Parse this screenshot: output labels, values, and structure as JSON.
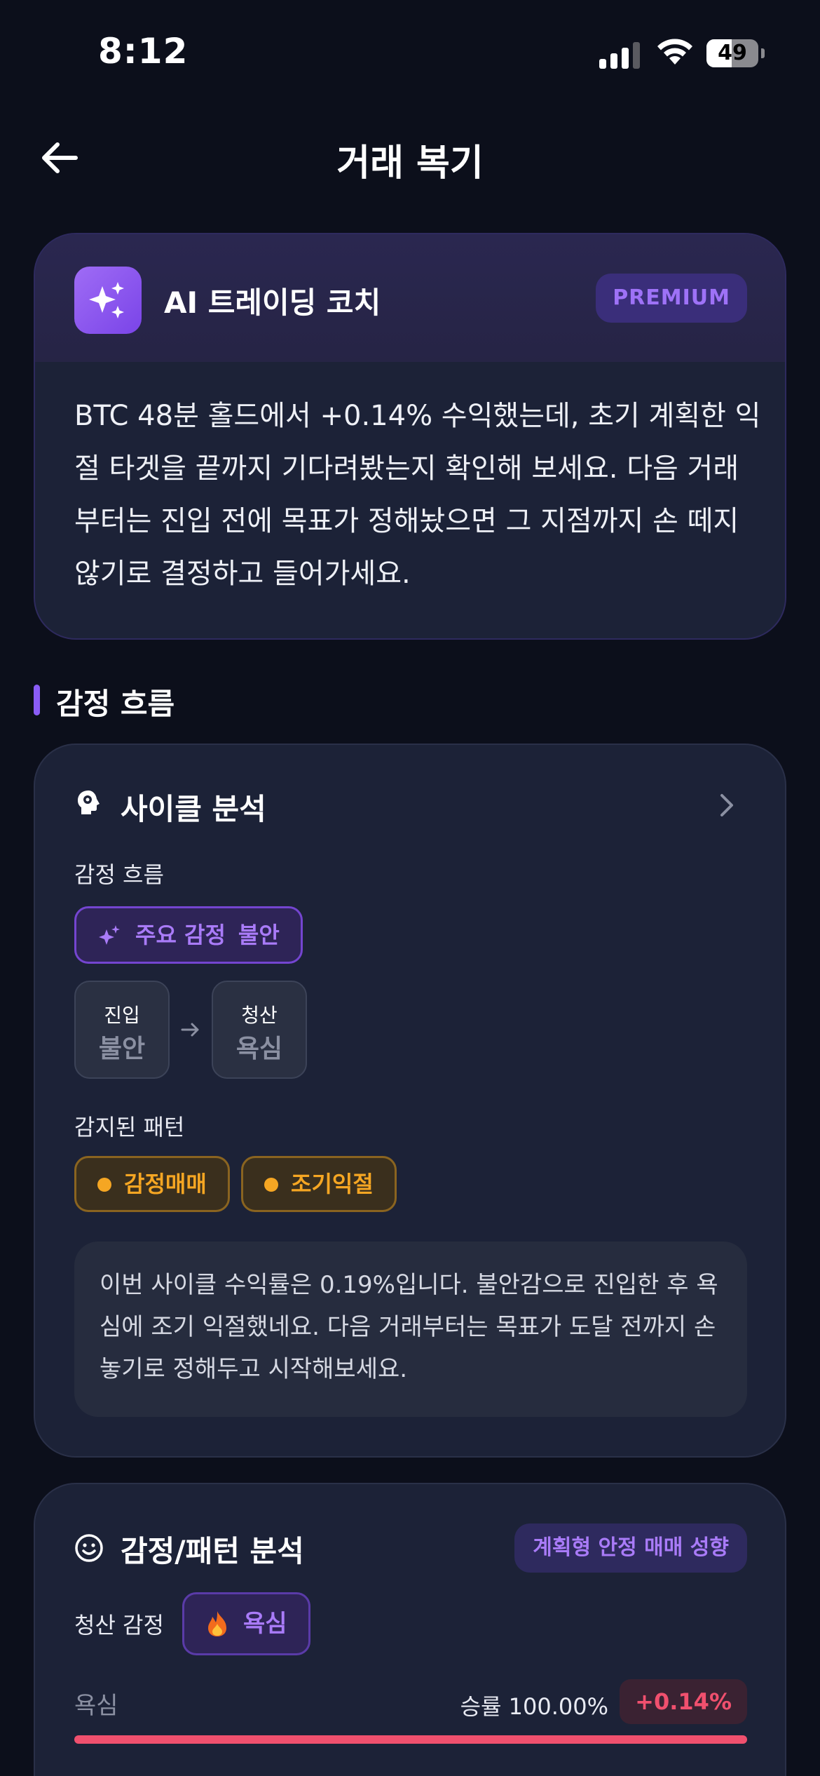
{
  "status_bar": {
    "time": "8:12",
    "battery": "49",
    "battery_level": 0.49
  },
  "header": {
    "title": "거래 복기"
  },
  "coach": {
    "title": "AI 트레이딩 코치",
    "badge": "PREMIUM",
    "message": "BTC 48분 홀드에서 +0.14% 수익했는데, 초기 계획한 익절 타겟을 끝까지 기다려봤는지 확인해 보세요. 다음 거래부터는 진입 전에 목표가 정해놨으면 그 지점까지 손 떼지 않기로 결정하고 들어가세요."
  },
  "section": {
    "title": "감정 흐름"
  },
  "cycle": {
    "title": "사이클 분석",
    "flow_label": "감정 흐름",
    "main_emotion_label": "주요 감정",
    "main_emotion_value": "불안",
    "entry": {
      "label": "진입",
      "value": "불안"
    },
    "exit": {
      "label": "청산",
      "value": "욕심"
    },
    "patterns_label": "감지된 패턴",
    "patterns": [
      "감정매매",
      "조기익절"
    ],
    "note": "이번 사이클 수익률은 0.19%입니다. 불안감으로 진입한 후 욕심에 조기 익절했네요. 다음 거래부터는 목표가 도달 전까지 손 놓기로 정해두고 시작해보세요."
  },
  "emotion_pattern": {
    "title": "감정/패턴 분석",
    "tendency": "계획형 안정 매매 성향",
    "exit_label": "청산 감정",
    "exit_emotion": "욕심",
    "bar_label": "욕심",
    "winrate": "승률 100.00%",
    "pnl": "+0.14%",
    "bar_fill": 1.0
  },
  "colors": {
    "background": "#0c0f1b",
    "card": "#1c2237",
    "accent_purple": "#8a5cf6",
    "warning_orange": "#f5a623",
    "loss_red": "#f0506e"
  },
  "icons": {
    "back": "arrow-left-icon",
    "coach": "sparkles-icon",
    "cycle": "head-gear-icon",
    "chevron": "chevron-right-icon",
    "emotion": "smiley-icon",
    "fire": "fire-icon"
  }
}
